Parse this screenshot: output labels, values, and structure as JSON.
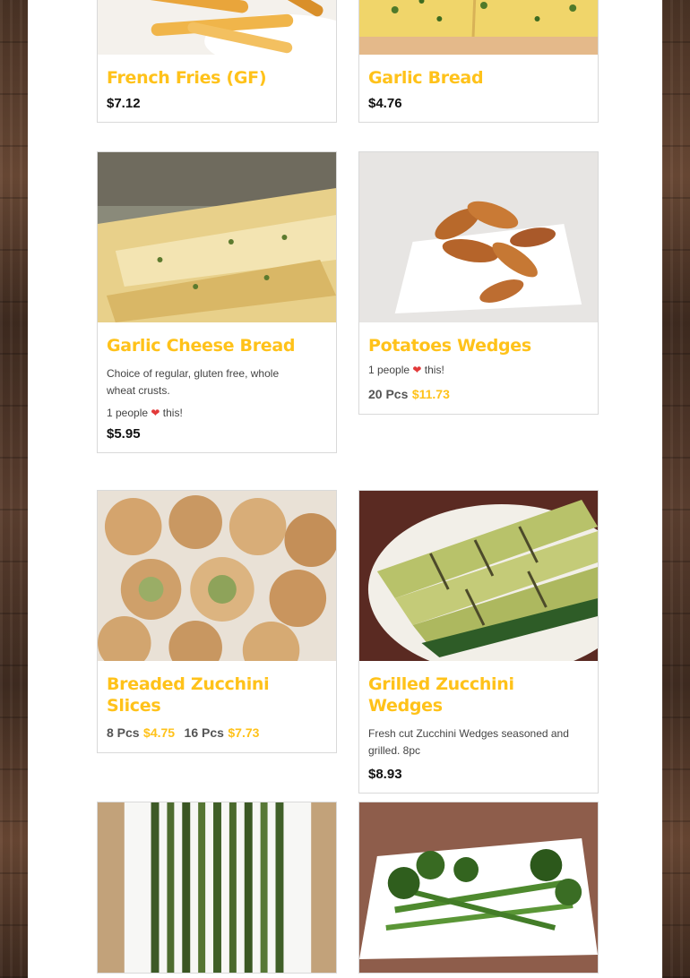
{
  "items": [
    {
      "name": "French Fries (GF)",
      "price": "$7.12"
    },
    {
      "name": "Garlic Bread",
      "price": "$4.76"
    },
    {
      "name": "Garlic Cheese Bread",
      "description": "Choice of regular, gluten free, whole wheat crusts.",
      "likes_prefix": "1 people",
      "likes_suffix": "this!",
      "price": "$5.95"
    },
    {
      "name": "Potatoes Wedges",
      "likes_prefix": "1 people",
      "likes_suffix": "this!",
      "options": [
        {
          "label": "20 Pcs",
          "price": "$11.73"
        }
      ]
    },
    {
      "name": "Breaded Zucchini Slices",
      "options": [
        {
          "label": "8 Pcs",
          "price": "$4.75"
        },
        {
          "label": "16 Pcs",
          "price": "$7.73"
        }
      ]
    },
    {
      "name": "Grilled Zucchini Wedges",
      "description": "Fresh cut Zucchini Wedges seasoned and grilled. 8pc",
      "price": "$8.93"
    },
    {},
    {}
  ],
  "theme": {
    "accent": "#ffc21a",
    "heart": "#e23a3a"
  }
}
